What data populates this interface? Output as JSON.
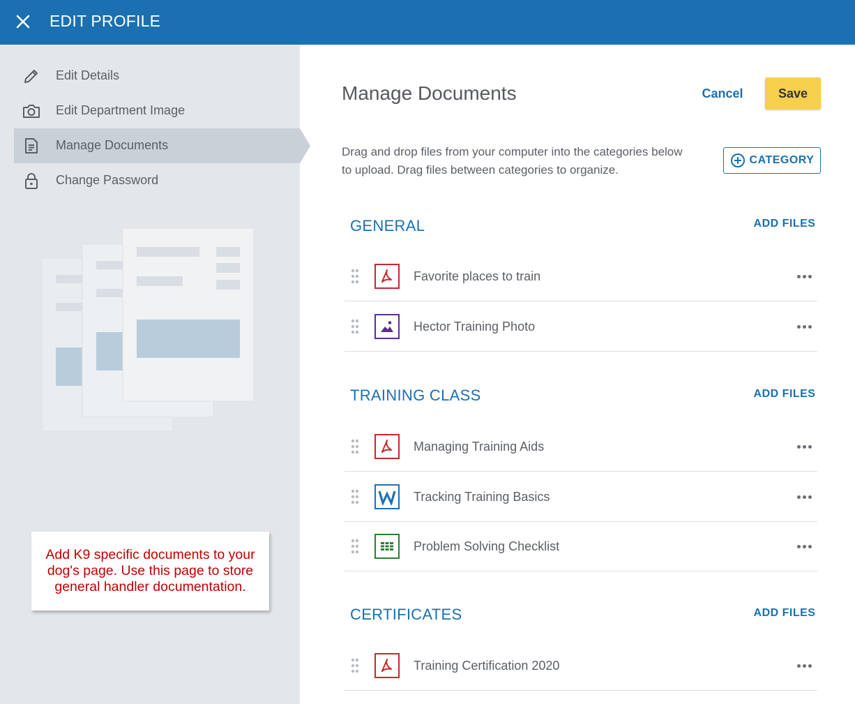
{
  "header": {
    "title": "EDIT PROFILE",
    "close_icon": "close-icon"
  },
  "sidebar": {
    "items": [
      {
        "label": "Edit Details",
        "icon": "pencil-icon",
        "active": false
      },
      {
        "label": "Edit Department Image",
        "icon": "camera-icon",
        "active": false
      },
      {
        "label": "Manage Documents",
        "icon": "document-icon",
        "active": true
      },
      {
        "label": "Change Password",
        "icon": "lock-icon",
        "active": false
      }
    ],
    "note": "Add K9 specific documents to your dog's page. Use this page to store general handler documentation."
  },
  "main": {
    "title": "Manage Documents",
    "cancel_label": "Cancel",
    "save_label": "Save",
    "instructions": "Drag and drop files from your computer into the categories below to upload. Drag files between categories to organize.",
    "category_button_label": "CATEGORY",
    "add_files_label": "ADD FILES",
    "sections": [
      {
        "title": "GENERAL",
        "files": [
          {
            "name": "Favorite places to train",
            "type": "pdf"
          },
          {
            "name": "Hector Training Photo",
            "type": "image"
          }
        ]
      },
      {
        "title": "TRAINING CLASS",
        "files": [
          {
            "name": "Managing Training Aids",
            "type": "pdf"
          },
          {
            "name": "Tracking Training Basics",
            "type": "word"
          },
          {
            "name": "Problem Solving Checklist",
            "type": "spreadsheet"
          }
        ]
      },
      {
        "title": "CERTIFICATES",
        "files": [
          {
            "name": "Training Certification 2020",
            "type": "pdf"
          }
        ]
      }
    ]
  },
  "colors": {
    "header_bg": "#1a70b0",
    "accent": "#1a70b0",
    "save_bg": "#f6cf4c",
    "sidebar_bg": "#e3e7ea",
    "note_text": "#c00000",
    "pdf": "#c62828",
    "image": "#5e2d91",
    "word": "#1f6fb5",
    "spreadsheet": "#2e7d32"
  }
}
